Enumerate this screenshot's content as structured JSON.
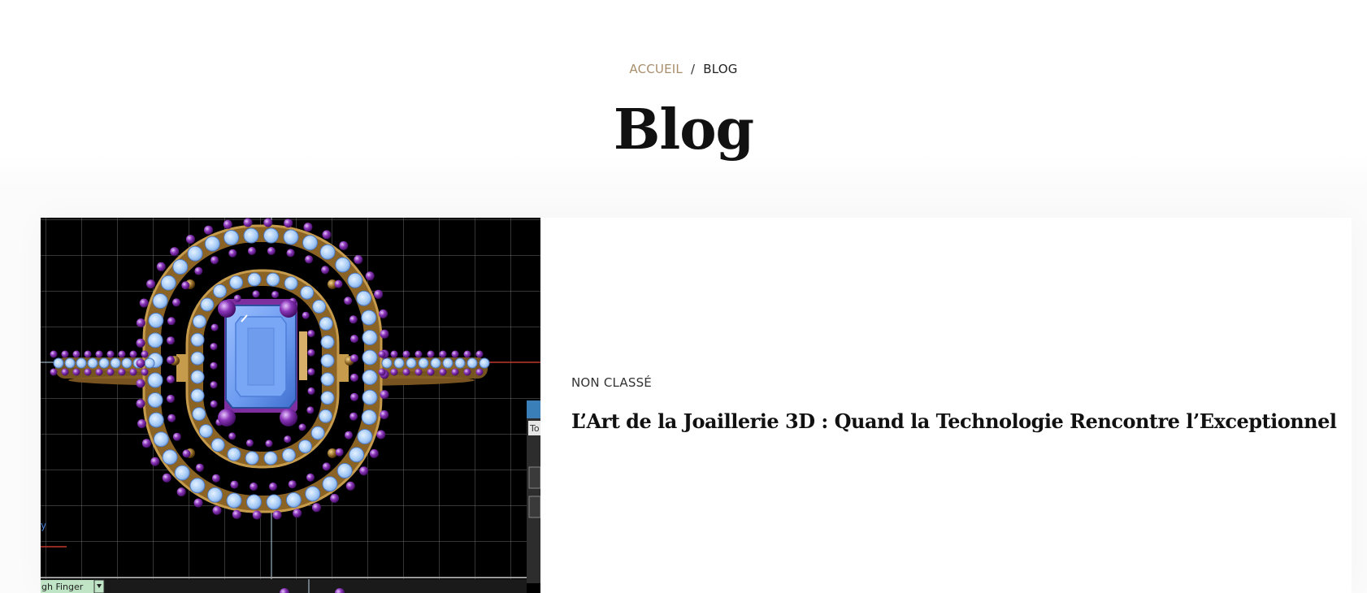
{
  "breadcrumb": {
    "home_label": "ACCUEIL",
    "separator": "/",
    "current_label": "BLOG"
  },
  "page_title": "Blog",
  "posts": [
    {
      "category": "NON CLASSÉ",
      "title": "L’Art de la Joaillerie 3D : Quand la Technologie Rencontre l’Exceptionnel",
      "thumbnail": {
        "ui_text": {
          "finger_label": "gh Finger",
          "panel_label": "To",
          "axis_label": "y"
        }
      }
    }
  ],
  "colors": {
    "accent": "#a88e6b",
    "text": "#111111",
    "ring_gold": "#9a6f2a",
    "gem_blue": "#6f9fec",
    "stone_purple": "#7d2fa0",
    "pave_light": "#9fc6f5"
  }
}
